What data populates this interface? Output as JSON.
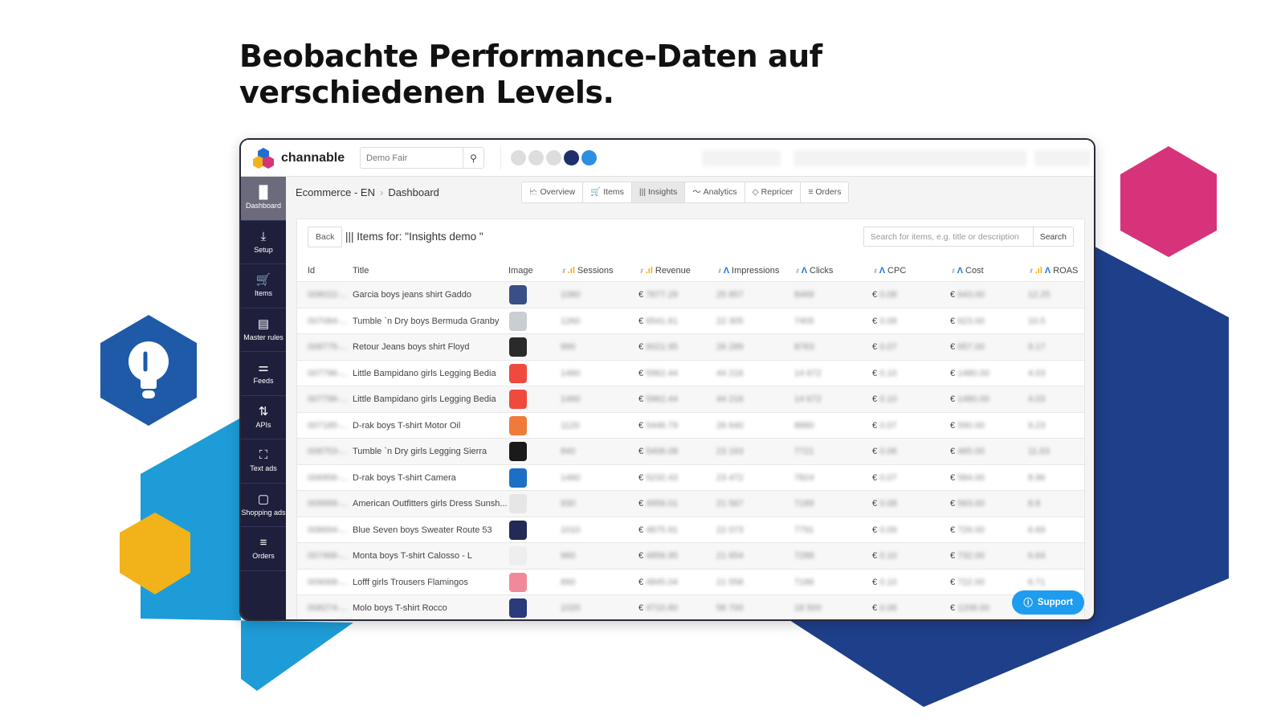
{
  "headline": {
    "line1": "Beobachte Performance-Daten auf",
    "line2": "verschiedenen Levels."
  },
  "colors": {
    "sidebar": "#1e1f3b",
    "accent": "#1e9cf0",
    "pink": "#d6337b",
    "blue": "#1e9cd7",
    "navy": "#1e3f8a",
    "yellow": "#f2b21a"
  },
  "app": {
    "logo": "channable",
    "search_value": "Demo Fair",
    "search_icon": "magnifier"
  },
  "sidebar": [
    {
      "label": "Dashboard",
      "icon": "bar-chart",
      "active": true
    },
    {
      "label": "Setup",
      "icon": "download"
    },
    {
      "label": "Items",
      "icon": "cart"
    },
    {
      "label": "Master rules",
      "icon": "clipboard"
    },
    {
      "label": "Feeds",
      "icon": "sliders"
    },
    {
      "label": "APIs",
      "icon": "arrows-updown"
    },
    {
      "label": "Text ads",
      "icon": "frame"
    },
    {
      "label": "Shopping ads",
      "icon": "bag"
    },
    {
      "label": "Orders",
      "icon": "list"
    }
  ],
  "breadcrumb": {
    "project": "Ecommerce - EN",
    "page": "Dashboard"
  },
  "tabs": [
    {
      "label": "Overview",
      "icon": "🗠"
    },
    {
      "label": "Items",
      "icon": "🛒"
    },
    {
      "label": "Insights",
      "icon": "|||",
      "active": true
    },
    {
      "label": "Analytics",
      "icon": "〜"
    },
    {
      "label": "Repricer",
      "icon": "◇"
    },
    {
      "label": "Orders",
      "icon": "≡"
    }
  ],
  "panel": {
    "back": "Back",
    "title": "Items for: \"Insights demo \"",
    "search_placeholder": "Search for items, e.g. title or description",
    "search_button": "Search"
  },
  "columns": [
    "Id",
    "Title",
    "Image",
    "Sessions",
    "Revenue",
    "Impressions",
    "Clicks",
    "CPC",
    "Cost",
    "ROAS"
  ],
  "rows": [
    {
      "id": "008022-...",
      "title": "Garcia boys jeans shirt Gaddo",
      "image_color": "#3a4f86",
      "sessions": "1080",
      "revenue": "€ 7677.29",
      "impressions": "25 857",
      "clicks": "8469",
      "cpc": "€ 0.08",
      "cost": "€ 643.00",
      "roas": "12.25"
    },
    {
      "id": "007084-...",
      "title": "Tumble `n Dry boys Bermuda Granby",
      "image_color": "#c9ced3",
      "sessions": "1260",
      "revenue": "€ 6541.61",
      "impressions": "22 305",
      "clicks": "7405",
      "cpc": "€ 0.08",
      "cost": "€ 623.00",
      "roas": "10.5"
    },
    {
      "id": "008775-...",
      "title": "Retour Jeans boys shirt Floyd",
      "image_color": "#2a2a2a",
      "sessions": "990",
      "revenue": "€ 6021.95",
      "impressions": "26 289",
      "clicks": "8763",
      "cpc": "€ 0.07",
      "cost": "€ 657.00",
      "roas": "9.17"
    },
    {
      "id": "007796-...",
      "title": "Little Bampidano girls Legging Bedia",
      "image_color": "#f04a3e",
      "sessions": "1460",
      "revenue": "€ 5962.44",
      "impressions": "44 216",
      "clicks": "14 672",
      "cpc": "€ 0.10",
      "cost": "€ 1480.00",
      "roas": "4.03"
    },
    {
      "id": "007796-...",
      "title": "Little Bampidano girls Legging Bedia",
      "image_color": "#f04a3e",
      "sessions": "1460",
      "revenue": "€ 5962.44",
      "impressions": "44 216",
      "clicks": "14 672",
      "cpc": "€ 0.10",
      "cost": "€ 1480.00",
      "roas": "4.03"
    },
    {
      "id": "007185-...",
      "title": "D-rak boys T-shirt Motor Oil",
      "image_color": "#f07a3a",
      "sessions": "1120",
      "revenue": "€ 5446.79",
      "impressions": "26 640",
      "clicks": "8880",
      "cpc": "€ 0.07",
      "cost": "€ 590.00",
      "roas": "9.23"
    },
    {
      "id": "008753-...",
      "title": "Tumble `n Dry girls Legging Sierra",
      "image_color": "#1a1a1a",
      "sessions": "840",
      "revenue": "€ 5406.08",
      "impressions": "23 163",
      "clicks": "7721",
      "cpc": "€ 0.06",
      "cost": "€ 465.00",
      "roas": "11.63"
    },
    {
      "id": "006956-...",
      "title": "D-rak boys T-shirt Camera",
      "image_color": "#1c6fc4",
      "sessions": "1460",
      "revenue": "€ 5232.43",
      "impressions": "23 472",
      "clicks": "7824",
      "cpc": "€ 0.07",
      "cost": "€ 584.00",
      "roas": "8.96"
    },
    {
      "id": "009999-...",
      "title": "American Outfitters girls Dress Sunsh...",
      "image_color": "#e6e6e6",
      "sessions": "930",
      "revenue": "€ 4956.01",
      "impressions": "21 567",
      "clicks": "7189",
      "cpc": "€ 0.08",
      "cost": "€ 563.00",
      "roas": "8.8"
    },
    {
      "id": "008694-...",
      "title": "Blue Seven boys Sweater Route 53",
      "image_color": "#232a55",
      "sessions": "1010",
      "revenue": "€ 4875.91",
      "impressions": "22 073",
      "clicks": "7791",
      "cpc": "€ 0.09",
      "cost": "€ 729.00",
      "roas": "6.69"
    },
    {
      "id": "007466-...",
      "title": "Monta boys T-shirt Calosso - L",
      "image_color": "#eeeeee",
      "sessions": "960",
      "revenue": "€ 4856.95",
      "impressions": "21 654",
      "clicks": "7288",
      "cpc": "€ 0.10",
      "cost": "€ 732.00",
      "roas": "6.64"
    },
    {
      "id": "009068-...",
      "title": "Lofff girls Trousers Flamingos",
      "image_color": "#f08a9a",
      "sessions": "890",
      "revenue": "€ 4845.04",
      "impressions": "21 558",
      "clicks": "7186",
      "cpc": "€ 0.10",
      "cost": "€ 722.00",
      "roas": "6.71"
    },
    {
      "id": "008274-...",
      "title": "Molo boys T-shirt Rocco",
      "image_color": "#2a3a7a",
      "sessions": "1020",
      "revenue": "€ 4710.80",
      "impressions": "56 700",
      "clicks": "18 500",
      "cpc": "€ 0.06",
      "cost": "€ 1208.00",
      "roas": "3.9"
    }
  ],
  "support": "Support"
}
